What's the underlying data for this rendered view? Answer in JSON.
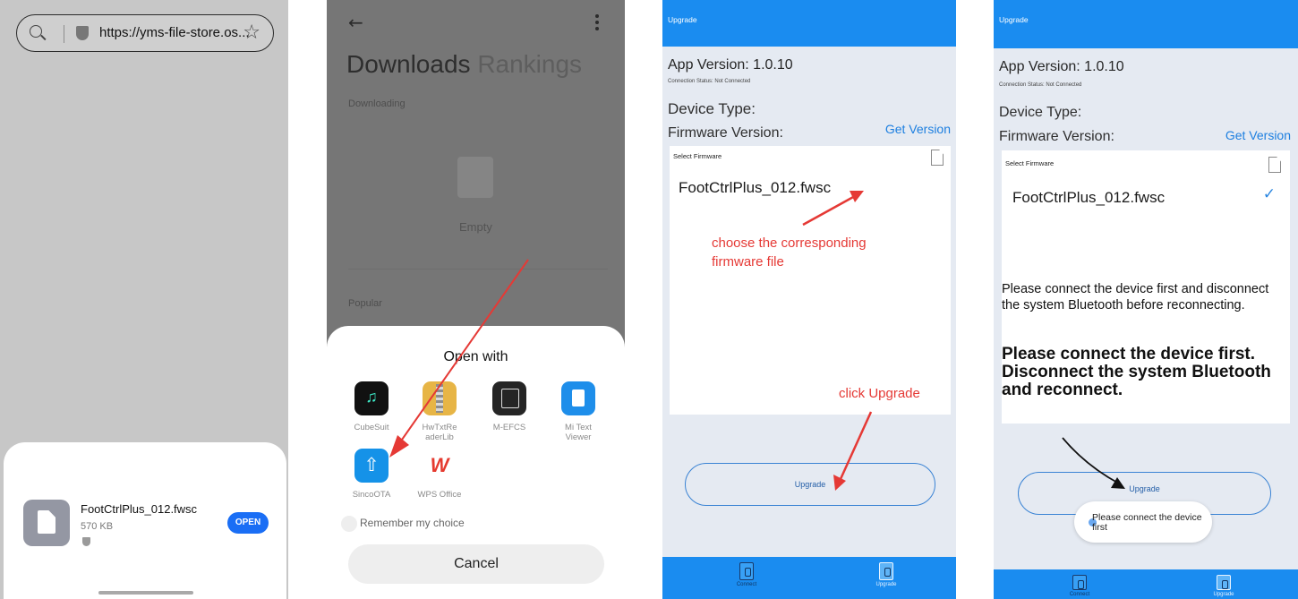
{
  "colors": {
    "accent_blue": "#1a8cf0",
    "open_blue": "#1a6ef5",
    "annotation_red": "#e53935",
    "dim_overlay": "#767676"
  },
  "panel1": {
    "url": "https://yms-file-store.os...",
    "file_name": "FootCtrlPlus_012.fwsc",
    "file_size": "570 KB",
    "open_label": "OPEN",
    "icons": [
      "search-icon",
      "shield-icon",
      "star-icon",
      "file-icon"
    ]
  },
  "panel2": {
    "tab_downloads": "Downloads",
    "tab_rankings": "Rankings",
    "section_downloading": "Downloading",
    "empty_label": "Empty",
    "section_popular": "Popular",
    "open_with_title": "Open with",
    "apps": [
      {
        "label": "CubeSuit",
        "icon": "cubesuit-icon"
      },
      {
        "label": "HwTxtReaderLib",
        "icon": "hwtxtreader-icon"
      },
      {
        "label": "M-EFCS",
        "icon": "mefcs-icon"
      },
      {
        "label": "Mi Text Viewer",
        "icon": "mi-text-viewer-icon"
      },
      {
        "label": "SincoOTA",
        "icon": "sincoota-icon"
      },
      {
        "label": "WPS Office",
        "icon": "wps-office-icon"
      }
    ],
    "remember_label": "Remember my choice",
    "cancel_label": "Cancel"
  },
  "panel3": {
    "header_title": "Upgrade",
    "app_version": "App Version: 1.0.10",
    "connection_status": "Connection Status: Not Connected",
    "device_type_label": "Device Type:",
    "firmware_version_label": "Firmware Version:",
    "get_version_label": "Get Version",
    "select_firmware_label": "Select Firmware",
    "firmware_file": "FootCtrlPlus_012.fwsc",
    "annotation_choose_line1": "choose the corresponding",
    "annotation_choose_line2": "firmware file",
    "annotation_click": "click Upgrade",
    "upgrade_button": "Upgrade",
    "tab_connect": "Connect",
    "tab_upgrade": "Upgrade"
  },
  "panel4": {
    "header_title": "Upgrade",
    "app_version": "App Version: 1.0.10",
    "connection_status": "Connection Status: Not Connected",
    "device_type_label": "Device Type:",
    "firmware_version_label": "Firmware Version:",
    "get_version_label": "Get Version",
    "select_firmware_label": "Select Firmware",
    "firmware_file": "FootCtrlPlus_012.fwsc",
    "message_small": "Please connect the device first and disconnect the system Bluetooth before reconnecting.",
    "message_large": "Please connect the device first. Disconnect the system Bluetooth and reconnect.",
    "upgrade_button": "Upgrade",
    "toast": "Please connect the device first",
    "tab_connect": "Connect",
    "tab_upgrade": "Upgrade"
  }
}
